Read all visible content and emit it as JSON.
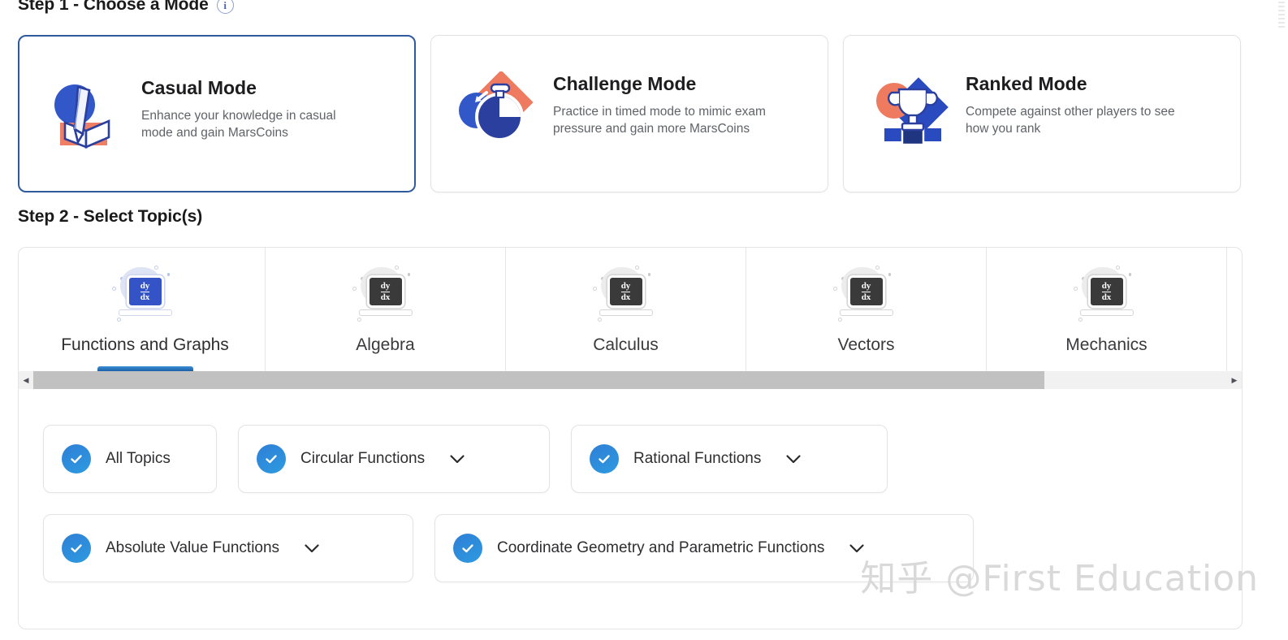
{
  "step1": {
    "heading": "Step 1 - Choose a Mode",
    "info_icon": "info-icon",
    "info_glyph": "i",
    "modes": [
      {
        "title": "Casual Mode",
        "desc": "Enhance your knowledge in casual mode and gain MarsCoins",
        "icon": "pencil-book-icon",
        "selected": true
      },
      {
        "title": "Challenge Mode",
        "desc": "Practice in timed mode to mimic exam pressure and gain more MarsCoins",
        "icon": "stopwatch-icon",
        "selected": false
      },
      {
        "title": "Ranked Mode",
        "desc": "Compete against other players to see how you rank",
        "icon": "trophy-icon",
        "selected": false
      }
    ]
  },
  "step2": {
    "heading": "Step 2 - Select Topic(s)",
    "tabs": [
      {
        "label": "Functions and Graphs",
        "active": true,
        "icon": "laptop-dydx-icon"
      },
      {
        "label": "Algebra",
        "active": false,
        "icon": "laptop-dydx-icon"
      },
      {
        "label": "Calculus",
        "active": false,
        "icon": "laptop-dydx-icon"
      },
      {
        "label": "Vectors",
        "active": false,
        "icon": "laptop-dydx-icon"
      },
      {
        "label": "Mechanics",
        "active": false,
        "icon": "laptop-dydx-icon"
      }
    ],
    "tab_icon_text": {
      "numerator": "dy",
      "denominator": "dx"
    },
    "scrollbar": {
      "left_arrow": "◀",
      "right_arrow": "▶",
      "orientation": "horizontal"
    },
    "topics_row1": [
      {
        "label": "All Topics",
        "checked": true,
        "expandable": false
      },
      {
        "label": "Circular Functions",
        "checked": true,
        "expandable": true
      },
      {
        "label": "Rational Functions",
        "checked": true,
        "expandable": true
      }
    ],
    "topics_row2": [
      {
        "label": "Absolute Value Functions",
        "checked": true,
        "expandable": true
      },
      {
        "label": "Coordinate Geometry and Parametric Functions",
        "checked": true,
        "expandable": true
      }
    ]
  },
  "watermark": {
    "text": "知乎 @First Education"
  },
  "colors": {
    "selected_border": "#2e5b9e",
    "check_blue": "#2f8ad8",
    "tab_underline": "#1a5fa8",
    "icon_blue": "#3453c6",
    "icon_coral": "#ee7a5f",
    "text_primary": "#1d1d1f",
    "text_secondary": "#5f6368"
  }
}
